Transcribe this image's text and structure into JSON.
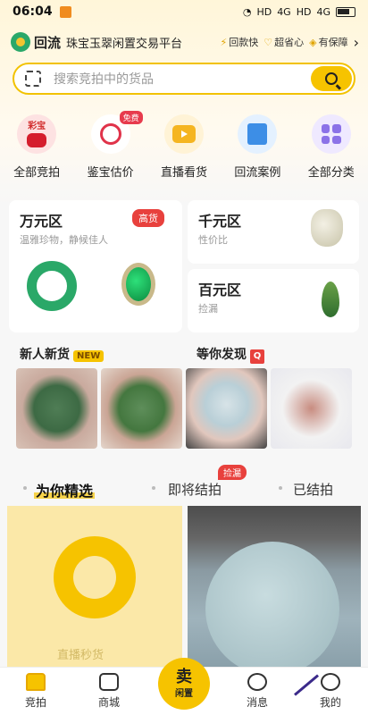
{
  "status": {
    "time": "06:04",
    "net1": "HD",
    "net2": "4G",
    "net3": "HD",
    "net4": "4G"
  },
  "brand": {
    "name": "回流",
    "slogan": "珠宝玉翠闲置交易平台",
    "badges": [
      "回款快",
      "超省心",
      "有保障"
    ]
  },
  "search": {
    "placeholder": "搜索竞拍中的货品"
  },
  "categories": [
    {
      "label": "全部竞拍",
      "icon_text": "彩宝"
    },
    {
      "label": "鉴宝估价",
      "tag": "免费"
    },
    {
      "label": "直播看货"
    },
    {
      "label": "回流案例"
    },
    {
      "label": "全部分类"
    }
  ],
  "zones": {
    "wan": {
      "title": "万元区",
      "sub": "温雅珍物，静候佳人",
      "tag": "高货"
    },
    "qian": {
      "title": "千元区",
      "sub": "性价比"
    },
    "bai": {
      "title": "百元区",
      "sub": "捡漏"
    }
  },
  "sections": {
    "new_title": "新人新货",
    "new_tag": "NEW",
    "find_title": "等你发现",
    "find_tag": "Q"
  },
  "tabs": {
    "recommend": "为你精选",
    "ending": "即将结拍",
    "ending_tag": "捡漏",
    "ended": "已结拍"
  },
  "feed": {
    "left_caption": "直播秒货"
  },
  "tabbar": {
    "home": "竞拍",
    "mall": "商城",
    "sell_big": "卖",
    "sell_small": "闲置",
    "msg": "消息",
    "me": "我的"
  },
  "colors": {
    "accent": "#f6c300",
    "red": "#e8413d",
    "green": "#2aa868"
  }
}
